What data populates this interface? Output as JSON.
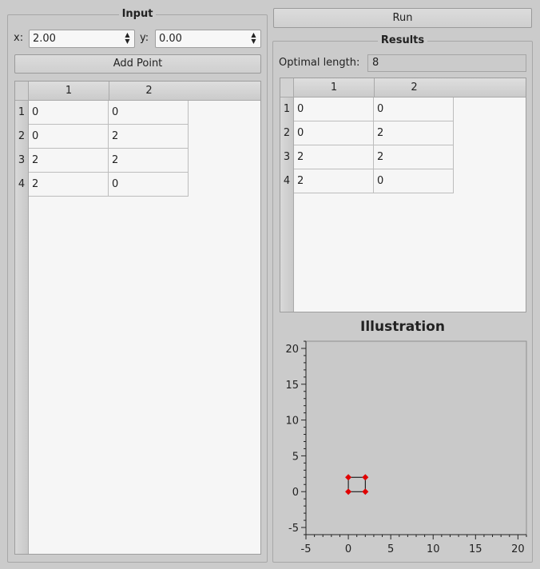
{
  "input": {
    "title": "Input",
    "x_label": "x:",
    "x_value": "2.00",
    "y_label": "y:",
    "y_value": "0.00",
    "add_point_label": "Add Point",
    "table": {
      "columns": [
        "1",
        "2"
      ],
      "row_headers": [
        "1",
        "2",
        "3",
        "4"
      ],
      "rows": [
        [
          "0",
          "0"
        ],
        [
          "0",
          "2"
        ],
        [
          "2",
          "2"
        ],
        [
          "2",
          "0"
        ]
      ]
    }
  },
  "run_label": "Run",
  "results": {
    "title": "Results",
    "optimal_length_label": "Optimal length:",
    "optimal_length_value": "8",
    "table": {
      "columns": [
        "1",
        "2"
      ],
      "row_headers": [
        "1",
        "2",
        "3",
        "4"
      ],
      "rows": [
        [
          "0",
          "0"
        ],
        [
          "0",
          "2"
        ],
        [
          "2",
          "2"
        ],
        [
          "2",
          "0"
        ]
      ]
    }
  },
  "chart_data": {
    "type": "scatter",
    "title": "Illustration",
    "xlim": [
      -5,
      21
    ],
    "ylim": [
      -6,
      21
    ],
    "x_ticks": [
      "-5",
      "0",
      "5",
      "10",
      "15",
      "20"
    ],
    "y_ticks": [
      "20",
      "15",
      "10",
      "5",
      "0",
      "-5"
    ],
    "points": [
      [
        0,
        0
      ],
      [
        0,
        2
      ],
      [
        2,
        2
      ],
      [
        2,
        0
      ]
    ],
    "closed_path": true,
    "point_color": "#e00000",
    "line_color": "#000000",
    "plot_background": "#c9c9c9"
  }
}
